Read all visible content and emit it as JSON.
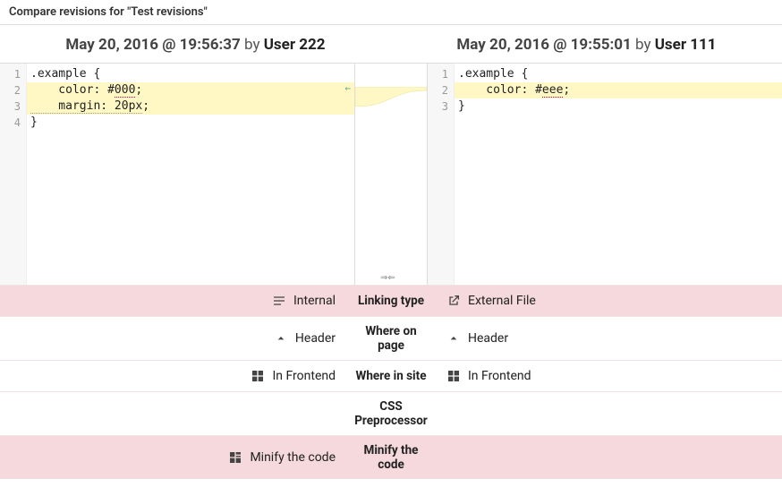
{
  "title": "Compare revisions for \"Test revisions\"",
  "left": {
    "datetime": "May 20, 2016 @ 19:56:37",
    "by": "by",
    "user": "User 222",
    "lines": [
      {
        "n": "1",
        "text": ".example {"
      },
      {
        "n": "2",
        "text": "    color: #000;",
        "hl": true,
        "chg": "000",
        "tail": ";"
      },
      {
        "n": "3",
        "text": "    margin: 20px;",
        "hl": true,
        "del": "    margin: 20px",
        "tail": ";"
      },
      {
        "n": "4",
        "text": "}"
      }
    ]
  },
  "right": {
    "datetime": "May 20, 2016 @ 19:55:01",
    "by": "by",
    "user": "User 111",
    "lines": [
      {
        "n": "1",
        "text": ".example {"
      },
      {
        "n": "2",
        "text": "    color: #eee;",
        "hl": true,
        "chg": "eee",
        "tail": ";"
      },
      {
        "n": "3",
        "text": "}"
      }
    ]
  },
  "arrow": "←",
  "merge": "⇒⇐",
  "props": [
    {
      "label": "Linking type",
      "left": "Internal",
      "right": "External File",
      "diff": true,
      "li": "internal",
      "ri": "external"
    },
    {
      "label": "Where on page",
      "left": "Header",
      "right": "Header",
      "diff": false,
      "li": "chev",
      "ri": "chev"
    },
    {
      "label": "Where in site",
      "left": "In Frontend",
      "right": "In Frontend",
      "diff": false,
      "li": "grid",
      "ri": "grid"
    },
    {
      "label": "CSS Preprocessor",
      "left": "",
      "right": "",
      "diff": false
    },
    {
      "label": "Minify the code",
      "left": "Minify the code",
      "right": "",
      "diff": true,
      "li": "minify"
    }
  ]
}
